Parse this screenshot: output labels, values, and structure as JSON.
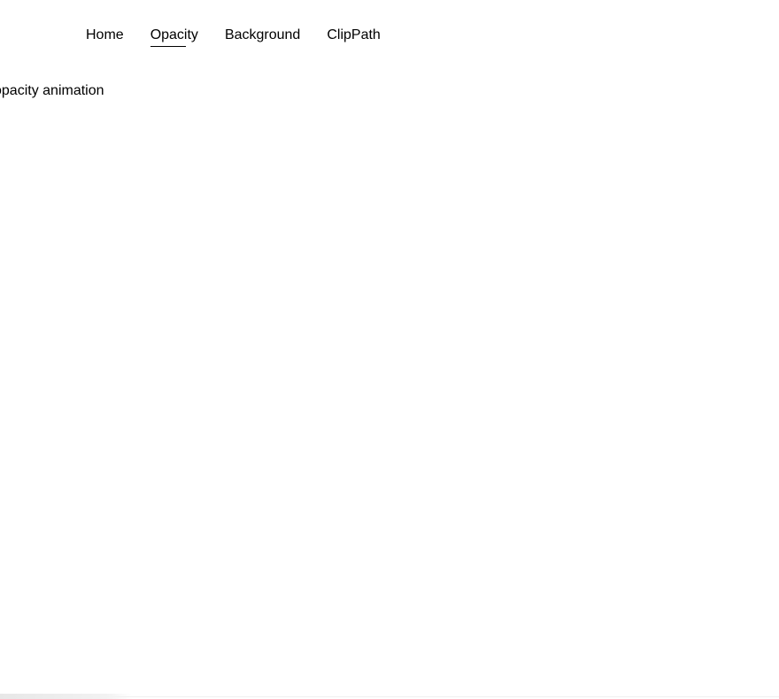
{
  "nav": {
    "items": [
      {
        "label": "Home",
        "active": false
      },
      {
        "label": "Opacity",
        "active": true
      },
      {
        "label": "Background",
        "active": false
      },
      {
        "label": "ClipPath",
        "active": false
      }
    ]
  },
  "main": {
    "text": "opacity animation"
  }
}
